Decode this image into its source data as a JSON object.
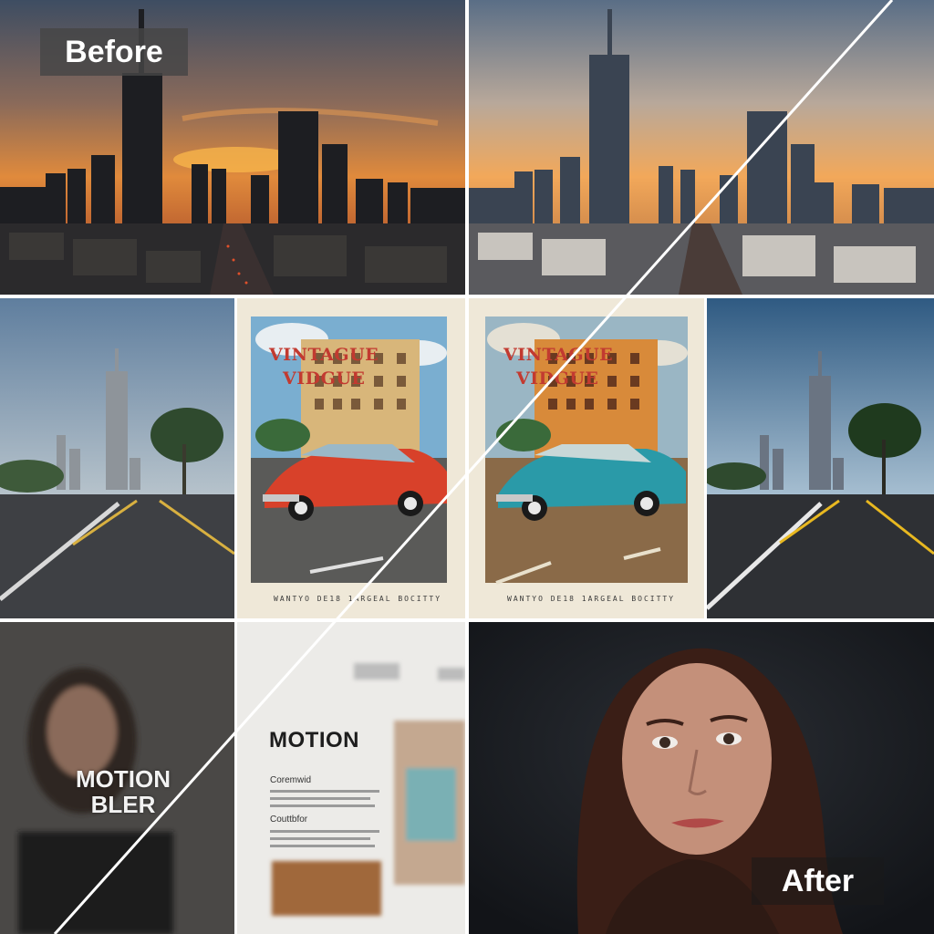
{
  "labels": {
    "before": "Before",
    "after": "After"
  },
  "posters": {
    "left_title_line1": "VINTAGUE",
    "left_title_line2": "VIDGUE",
    "left_footer": "WANTYO DE18 1ARGEAL BOCITTY",
    "right_title_line1": "VINTAGUE",
    "right_title_line2": "VIDGUE",
    "right_footer": "WANTYO DE18 1ARGEAL BOCITTY"
  },
  "portrait_blurred": {
    "overlay_line1": "MOTION",
    "overlay_line2": "BLER"
  },
  "magazine": {
    "heading": "MOTION",
    "subheading1": "Coremwid",
    "subheading2": "Couttbfor"
  },
  "colors": {
    "divider": "#ffffff",
    "sunset_orange": "#e88a3a",
    "car_red": "#d8412a",
    "car_teal": "#2a9aa8"
  }
}
